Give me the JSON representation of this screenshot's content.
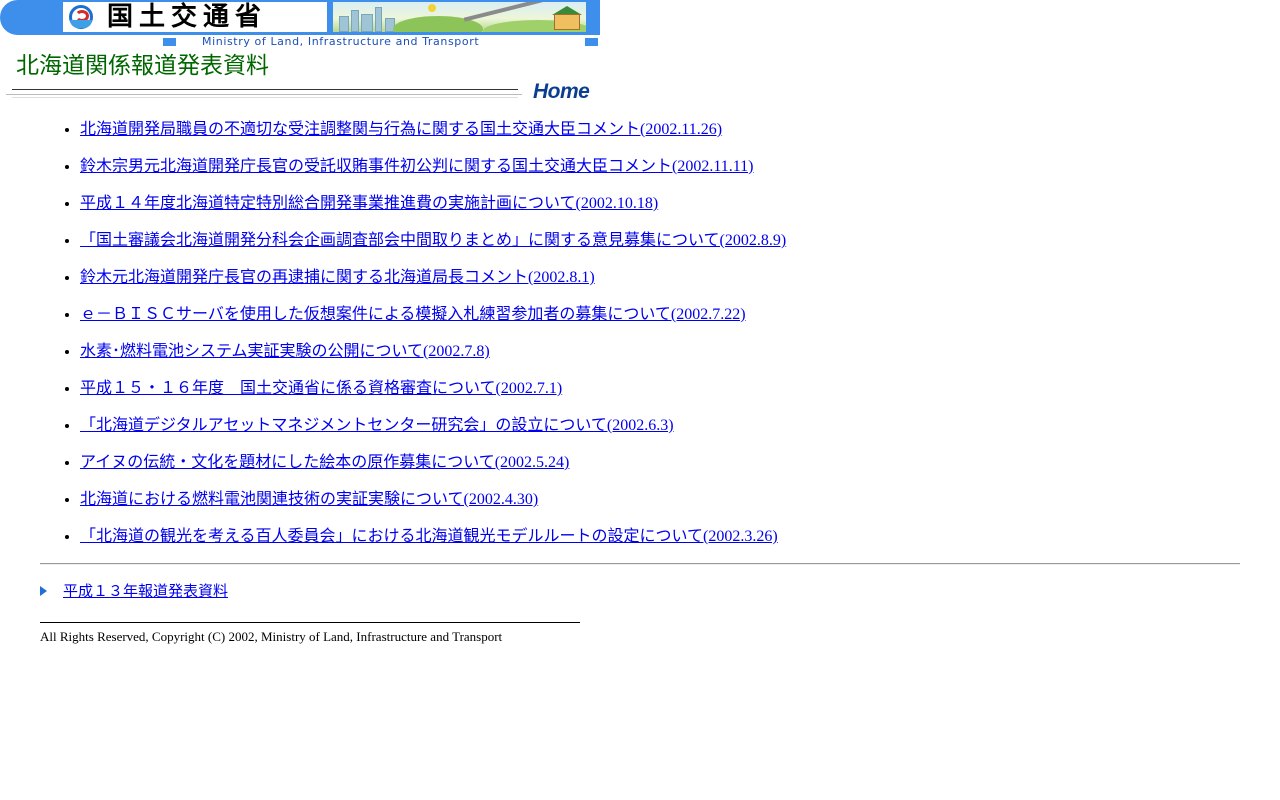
{
  "header": {
    "ministry_name_jp": "国土交通省",
    "ministry_name_en": "Ministry of Land, Infrastructure and Transport",
    "brand_color": "#3e8eec",
    "logo_icon": "mlit-emblem-icon",
    "scene_image": "landscape-banner-image"
  },
  "page": {
    "title": "北海道関係報道発表資料",
    "title_color": "#006600",
    "home_label": "Home"
  },
  "news": {
    "items": [
      {
        "label": "北海道開発局職員の不適切な受注調整関与行為に関する国土交通大臣コメント(2002.11.26)"
      },
      {
        "label": "鈴木宗男元北海道開発庁長官の受託収賄事件初公判に関する国土交通大臣コメント(2002.11.11)"
      },
      {
        "label": "平成１４年度北海道特定特別総合開発事業推進費の実施計画について(2002.10.18)"
      },
      {
        "label": "「国土審議会北海道開発分科会企画調査部会中間取りまとめ」に関する意見募集について(2002.8.9)"
      },
      {
        "label": "鈴木元北海道開発庁長官の再逮捕に関する北海道局長コメント(2002.8.1)"
      },
      {
        "label": "ｅ－ＢＩＳＣサーバを使用した仮想案件による模擬入札練習参加者の募集について(2002.7.22)"
      },
      {
        "label": "水素･燃料電池システム実証実験の公開について(2002.7.8)"
      },
      {
        "label": "平成１５・１６年度　国土交通省に係る資格審査について(2002.7.1)"
      },
      {
        "label": "「北海道デジタルアセットマネジメントセンター研究会」の設立について(2002.6.3)"
      },
      {
        "label": "アイヌの伝統・文化を題材にした絵本の原作募集について(2002.5.24)"
      },
      {
        "label": "北海道における燃料電池関連技術の実証実験について(2002.4.30)"
      },
      {
        "label": "「北海道の観光を考える百人委員会」における北海道観光モデルルートの設定について(2002.3.26)"
      }
    ],
    "link_color": "#0000ee"
  },
  "footer": {
    "archive_label": "平成１３年報道発表資料",
    "archive_icon": "arrow-right-icon",
    "copyright": "All Rights Reserved, Copyright (C) 2002, Ministry of Land, Infrastructure and Transport"
  }
}
